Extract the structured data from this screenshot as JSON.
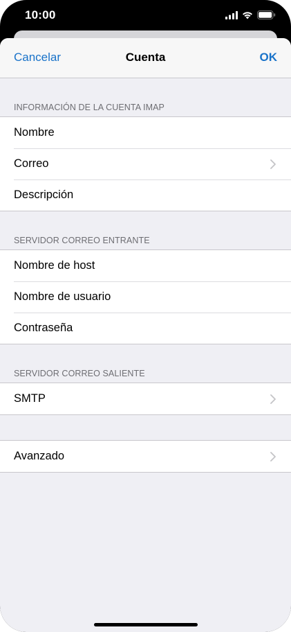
{
  "status": {
    "time": "10:00",
    "icons": [
      "cellular-signal-icon",
      "wifi-icon",
      "battery-icon"
    ]
  },
  "nav": {
    "cancel_label": "Cancelar",
    "title": "Cuenta",
    "ok_label": "OK"
  },
  "sections": {
    "imap": {
      "header": "INFORMACIÓN DE LA CUENTA IMAP",
      "rows": [
        "Nombre",
        "Correo",
        "Descripción"
      ]
    },
    "incoming": {
      "header": "SERVIDOR CORREO ENTRANTE",
      "rows": [
        "Nombre de host",
        "Nombre de usuario",
        "Contraseña"
      ]
    },
    "outgoing": {
      "header": "SERVIDOR CORREO SALIENTE",
      "rows": [
        "SMTP"
      ]
    },
    "advanced": {
      "rows": [
        "Avanzado"
      ]
    }
  },
  "colors": {
    "accent": "#1a73c9",
    "background": "#efeff4",
    "cell": "#ffffff",
    "header_text": "#6d6d72",
    "chevron": "#c4c4c7"
  }
}
